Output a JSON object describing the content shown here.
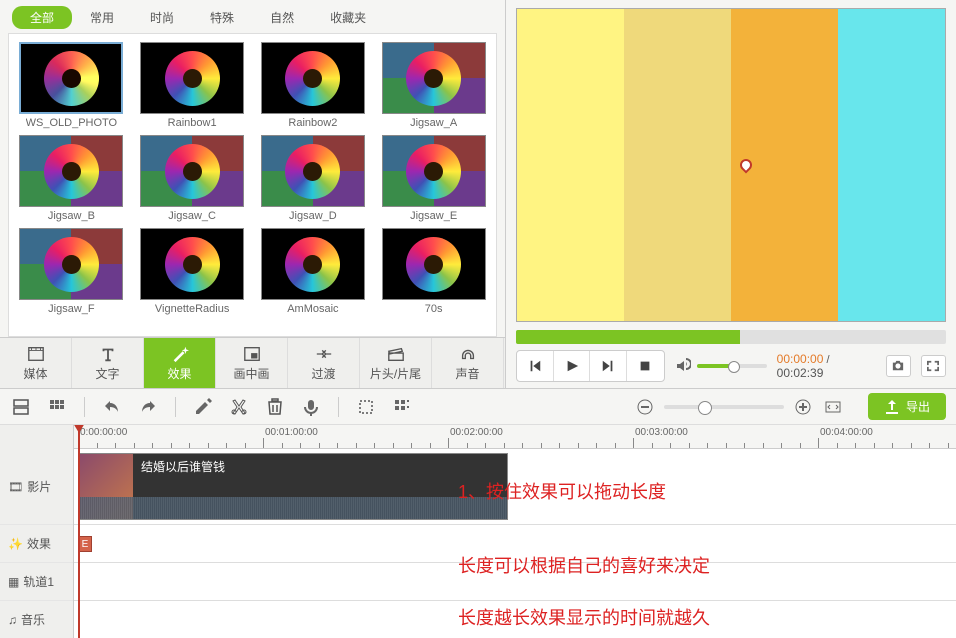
{
  "tabs": [
    "全部",
    "常用",
    "时尚",
    "特殊",
    "自然",
    "收藏夹"
  ],
  "effects": [
    {
      "name": "WS_OLD_PHOTO",
      "style": "old"
    },
    {
      "name": "Rainbow1",
      "style": "plain"
    },
    {
      "name": "Rainbow2",
      "style": "plain"
    },
    {
      "name": "Jigsaw_A",
      "style": "jigsaw"
    },
    {
      "name": "Jigsaw_B",
      "style": "jigsaw"
    },
    {
      "name": "Jigsaw_C",
      "style": "jigsaw"
    },
    {
      "name": "Jigsaw_D",
      "style": "jigsaw"
    },
    {
      "name": "Jigsaw_E",
      "style": "jigsaw"
    },
    {
      "name": "Jigsaw_F",
      "style": "jigsaw"
    },
    {
      "name": "VignetteRadius",
      "style": "plain"
    },
    {
      "name": "AmMosaic",
      "style": "plain"
    },
    {
      "name": "70s",
      "style": "plain"
    }
  ],
  "toolbar": [
    {
      "label": "媒体",
      "icon": "film"
    },
    {
      "label": "文字",
      "icon": "text"
    },
    {
      "label": "效果",
      "icon": "wand",
      "active": true
    },
    {
      "label": "画中画",
      "icon": "pip"
    },
    {
      "label": "过渡",
      "icon": "trans"
    },
    {
      "label": "片头/片尾",
      "icon": "clap"
    },
    {
      "label": "声音",
      "icon": "head"
    }
  ],
  "time": {
    "cur": "00:00:00",
    "dur": "00:02:39"
  },
  "ruler": [
    "0:00:00:00",
    "00:01:00:00",
    "00:02:00:00",
    "00:03:00:00",
    "00:04:00:00"
  ],
  "tracks": {
    "video": "影片",
    "fx": "效果",
    "t1": "轨道1",
    "music": "音乐"
  },
  "clip": {
    "title": "结婚以后谁管钱"
  },
  "fx_badge": "E",
  "export": "导出",
  "annotations": [
    "1、按住效果可以拖动长度",
    "长度可以根据自己的喜好来决定",
    "长度越长效果显示的时间就越久"
  ]
}
